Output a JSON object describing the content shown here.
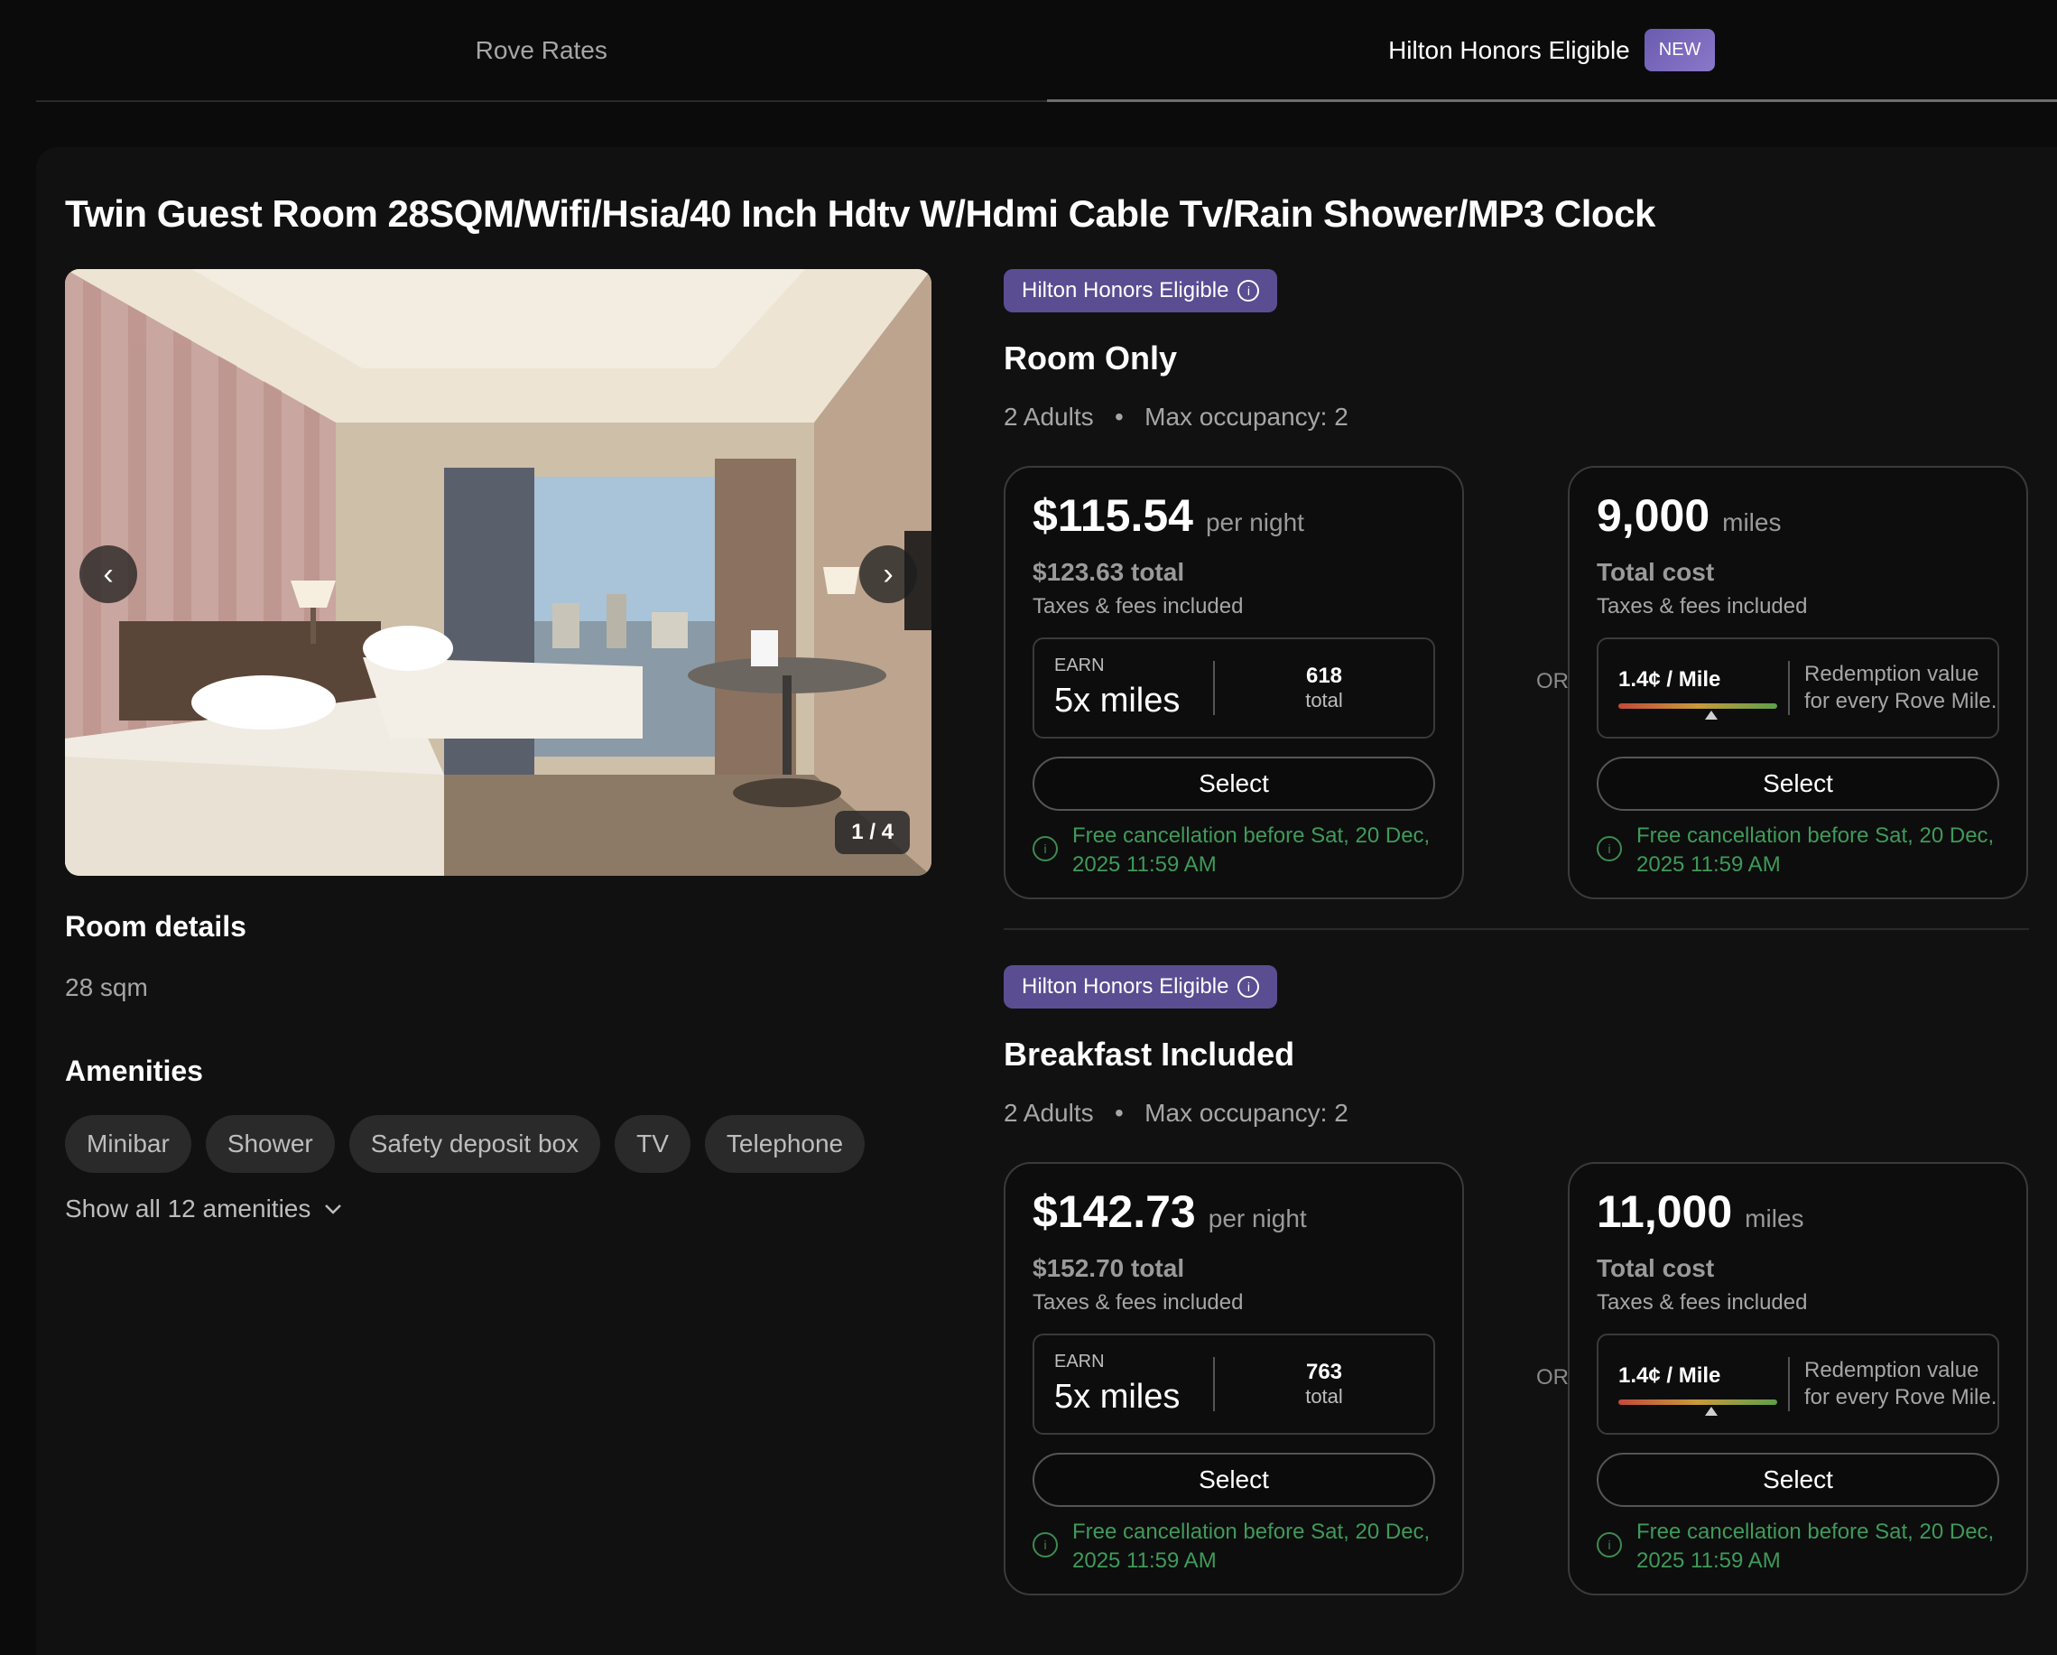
{
  "tabs": [
    {
      "label": "Rove Rates",
      "active": false
    },
    {
      "label": "Hilton Honors Eligible",
      "badge": "NEW",
      "active": true
    }
  ],
  "room": {
    "title": "Twin Guest Room 28SQM/Wifi/Hsia/40 Inch Hdtv W/Hdmi Cable Tv/Rain Shower/MP3 Clock",
    "photo_counter": "1 / 4",
    "details_heading": "Room details",
    "size": "28 sqm",
    "amenities_heading": "Amenities",
    "amenities": [
      "Minibar",
      "Shower",
      "Safety deposit box",
      "TV",
      "Telephone"
    ],
    "show_all": "Show all 12 amenities"
  },
  "rates": [
    {
      "badge": "Hilton Honors Eligible",
      "name": "Room Only",
      "adults": "2 Adults",
      "occupancy": "Max occupancy: 2",
      "cash": {
        "price": "$115.54",
        "unit": "per night",
        "total": "$123.63 total",
        "taxes": "Taxes & fees included",
        "earn_label": "EARN",
        "earn_value": "5x miles",
        "earn_total": "618",
        "earn_total_label": "total",
        "select": "Select",
        "cancellation": "Free cancellation before Sat, 20 Dec, 2025 11:59 AM"
      },
      "or": "OR",
      "miles": {
        "amount": "9,000",
        "unit": "miles",
        "total": "Total cost",
        "taxes": "Taxes & fees included",
        "redeem_value": "1.4¢ / Mile",
        "redeem_desc": "Redemption value for every Rove Mile.",
        "select": "Select",
        "cancellation": "Free cancellation before Sat, 20 Dec, 2025 11:59 AM"
      }
    },
    {
      "badge": "Hilton Honors Eligible",
      "name": "Breakfast Included",
      "adults": "2 Adults",
      "occupancy": "Max occupancy: 2",
      "cash": {
        "price": "$142.73",
        "unit": "per night",
        "total": "$152.70 total",
        "taxes": "Taxes & fees included",
        "earn_label": "EARN",
        "earn_value": "5x miles",
        "earn_total": "763",
        "earn_total_label": "total",
        "select": "Select",
        "cancellation": "Free cancellation before Sat, 20 Dec, 2025 11:59 AM"
      },
      "or": "OR",
      "miles": {
        "amount": "11,000",
        "unit": "miles",
        "total": "Total cost",
        "taxes": "Taxes & fees included",
        "redeem_value": "1.4¢ / Mile",
        "redeem_desc": "Redemption value for every Rove Mile.",
        "select": "Select",
        "cancellation": "Free cancellation before Sat, 20 Dec, 2025 11:59 AM"
      }
    }
  ],
  "colors": {
    "accent_purple": "#5b4d92",
    "cancellation_green": "#3f9a5a",
    "background": "#0b0b0b",
    "card": "#111111"
  }
}
